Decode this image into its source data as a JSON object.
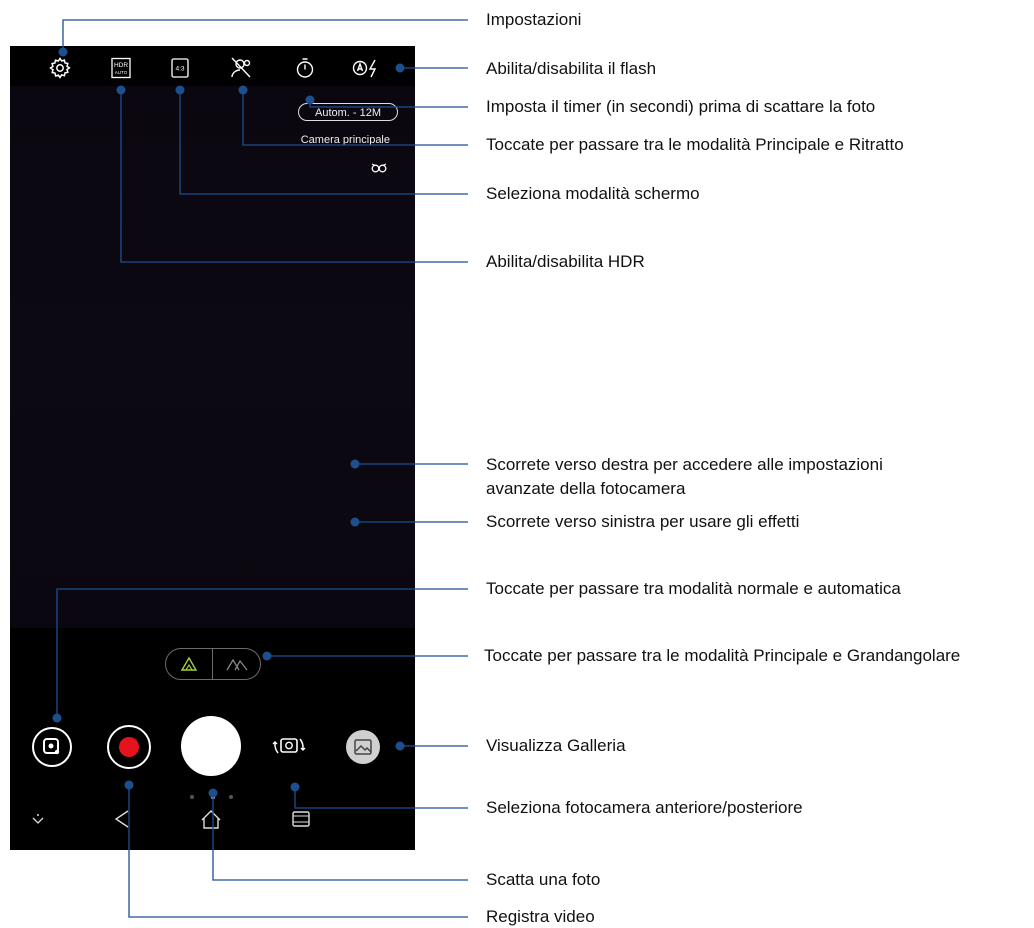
{
  "phone": {
    "resolution_label": "Autom. - 12M",
    "camera_mode_label": "Camera principale",
    "hdr_icon_text": "HDR",
    "hdr_icon_sub": "AUTO",
    "ratio_icon_text": "4:3"
  },
  "annotations": [
    {
      "id": "settings",
      "text": "Impostazioni"
    },
    {
      "id": "flash",
      "text": "Abilita/disabilita il flash"
    },
    {
      "id": "timer",
      "text": "Imposta il timer (in secondi) prima di scattare la foto"
    },
    {
      "id": "portrait",
      "text": "Toccate per passare tra le modalità Principale e Ritratto"
    },
    {
      "id": "screen-mode",
      "text": "Seleziona modalità schermo"
    },
    {
      "id": "hdr",
      "text": "Abilita/disabilita HDR"
    },
    {
      "id": "swipe-right",
      "text": "Scorrete verso destra per accedere alle impostazioni avanzate della fotocamera"
    },
    {
      "id": "swipe-left",
      "text": "Scorrete verso sinistra per usare gli effetti"
    },
    {
      "id": "auto-mode",
      "text": "Toccate per passare tra modalità normale e automatica"
    },
    {
      "id": "wide",
      "text": "Toccate per passare tra le modalità Principale e Grandangolare"
    },
    {
      "id": "gallery",
      "text": "Visualizza Galleria"
    },
    {
      "id": "front-rear",
      "text": "Seleziona fotocamera anteriore/posteriore"
    },
    {
      "id": "shoot",
      "text": "Scatta una foto"
    },
    {
      "id": "record",
      "text": "Registra video"
    }
  ],
  "colors": {
    "leader_line": "#1d4f8f",
    "shutter": "#ffffff",
    "record": "#e5141c",
    "background": "#000000"
  }
}
